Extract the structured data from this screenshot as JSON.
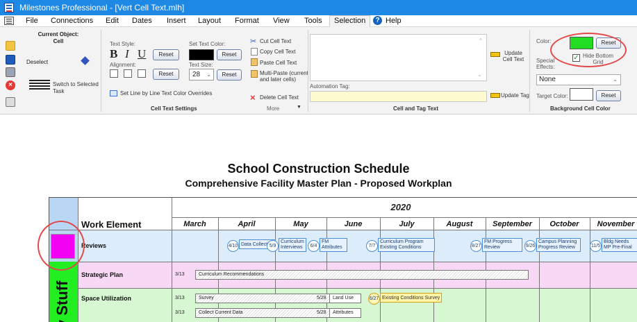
{
  "window": {
    "title": "Milestones Professional - [Vert Cell Text.mlh]"
  },
  "menu": [
    "File",
    "Connections",
    "Edit",
    "Dates",
    "Insert",
    "Layout",
    "Format",
    "View",
    "Tools",
    "Selection",
    "Help"
  ],
  "ribbon": {
    "current_object_label": "Current Object:",
    "current_object_value": "Cell",
    "deselect": "Deselect",
    "switch_to_selected": "Switch to Selected",
    "task": "Task",
    "text_style_label": "Text Style:",
    "bold": "B",
    "italic": "I",
    "underline": "U",
    "reset": "Reset",
    "alignment_label": "Alignment:",
    "set_text_color_label": "Set Text Color:",
    "text_color": "#000000",
    "text_size_label": "Text Size:",
    "text_size_value": "28",
    "set_line_by_line": "Set Line by Line Text Color Overrides",
    "cell_text_settings": "Cell Text Settings",
    "cut_cell_text": "Cut Cell Text",
    "copy_cell_text": "Copy Cell Text",
    "paste_cell_text": "Paste Cell Text",
    "multi_paste": "Multi-Paste (current and later cells)",
    "delete_cell_text": "Delete Cell Text",
    "more": "More",
    "automation_tag_label": "Automation Tag:",
    "update_cell_text": "Update Cell Text",
    "update_tag": "Update Tag",
    "cell_and_tag_text": "Cell and Tag Text",
    "color_label": "Color:",
    "bg_color": "#22dd22",
    "hide_bottom_grid": "Hide Bottom Grid",
    "special_effects_label": "Special Effects:",
    "special_effects_value": "None",
    "target_color_label": "Target Color:",
    "background_cell_color": "Background Cell Color"
  },
  "schedule": {
    "title": "School Construction Schedule",
    "subtitle": "Comprehensive Facility Master Plan - Proposed Workplan",
    "year": "2020",
    "work_element_header": "Work Element",
    "months": [
      "March",
      "April",
      "May",
      "June",
      "July",
      "August",
      "September",
      "October",
      "November"
    ],
    "vertical_cell_text": "y Stuff",
    "rows": [
      {
        "label": "Reviews"
      },
      {
        "label": "Strategic Plan"
      },
      {
        "label": "Space Utilization"
      }
    ],
    "reviews_milestones": [
      {
        "date": "4/10",
        "text": "Data Collection"
      },
      {
        "date": "5/9",
        "text": "Curriculum Interviews"
      },
      {
        "date": "6/4",
        "text": "FM Attributes"
      },
      {
        "date": "7/7",
        "text": "Curriculum Program Existing Conditions"
      },
      {
        "date": "8/27",
        "text": "FM Progress Review"
      },
      {
        "date": "9/26",
        "text": "Campus Planning Progress Review"
      },
      {
        "date": "11/5",
        "text": "Bldg Needs MP Pre-Final"
      }
    ],
    "strategic_bar": {
      "start": "3/13",
      "text": "Curriculum Recommendations"
    },
    "space_bars": [
      {
        "start": "3/13",
        "text": "Survey",
        "end": "5/28",
        "end_text": "Land Use"
      },
      {
        "start": "3/13",
        "text": "Collect Current Data",
        "end": "5/28",
        "end_text": "Attributes"
      }
    ],
    "existing_conditions": {
      "date": "6/27",
      "text": "Existing Conditions Survey"
    },
    "colors": {
      "reviews_bg": "#dcecfb",
      "strategic_bg": "#f7d9f5",
      "space_bg": "#d7f7d2",
      "magenta": "#f100f1",
      "green": "#22ee22"
    }
  }
}
